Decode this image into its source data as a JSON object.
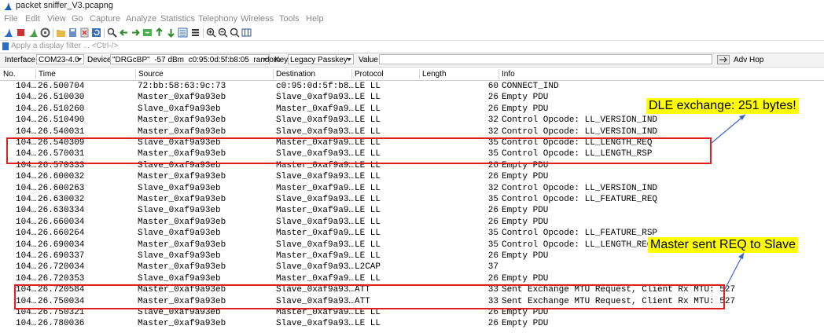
{
  "window": {
    "title": "packet sniffer_V3.pcapng"
  },
  "menu": [
    "File",
    "Edit",
    "View",
    "Go",
    "Capture",
    "Analyze",
    "Statistics",
    "Telephony",
    "Wireless",
    "Tools",
    "Help"
  ],
  "filter": {
    "placeholder": "Apply a display filter ... <Ctrl-/>"
  },
  "interface_bar": {
    "interface_label": "Interface",
    "interface_value": "COM23-4.0",
    "device_label": "Device",
    "device_value": "\"DRGcBP\"  -57 dBm  c0:95:0d:5f:b8:05  random",
    "key_label": "Key",
    "key_value": "Legacy Passkey",
    "value_label": "Value",
    "adv_hop_label": "Adv Hop"
  },
  "columns": [
    "No.",
    "Time",
    "Source",
    "Destination",
    "Protocol",
    "Length",
    "Info"
  ],
  "packets": [
    {
      "no": "104…",
      "time": "26.500704",
      "src": "72:bb:58:63:9c:73",
      "dst": "c0:95:0d:5f:b8…",
      "proto": "LE LL",
      "len": "60",
      "info": "CONNECT_IND"
    },
    {
      "no": "104…",
      "time": "26.510030",
      "src": "Master_0xaf9a93eb",
      "dst": "Slave_0xaf9a93…",
      "proto": "LE LL",
      "len": "26",
      "info": "Empty PDU"
    },
    {
      "no": "104…",
      "time": "26.510260",
      "src": "Slave_0xaf9a93eb",
      "dst": "Master_0xaf9a9…",
      "proto": "LE LL",
      "len": "26",
      "info": "Empty PDU"
    },
    {
      "no": "104…",
      "time": "26.510490",
      "src": "Master_0xaf9a93eb",
      "dst": "Slave_0xaf9a93…",
      "proto": "LE LL",
      "len": "32",
      "info": "Control Opcode: LL_VERSION_IND"
    },
    {
      "no": "104…",
      "time": "26.540031",
      "src": "Master_0xaf9a93eb",
      "dst": "Slave_0xaf9a93…",
      "proto": "LE LL",
      "len": "32",
      "info": "Control Opcode: LL_VERSION_IND"
    },
    {
      "no": "104…",
      "time": "26.540309",
      "src": "Slave_0xaf9a93eb",
      "dst": "Master_0xaf9a9…",
      "proto": "LE LL",
      "len": "35",
      "info": "Control Opcode: LL_LENGTH_REQ"
    },
    {
      "no": "104…",
      "time": "26.570031",
      "src": "Master_0xaf9a93eb",
      "dst": "Slave_0xaf9a93…",
      "proto": "LE LL",
      "len": "35",
      "info": "Control Opcode: LL_LENGTH_RSP"
    },
    {
      "no": "104…",
      "time": "26.570333",
      "src": "Slave_0xaf9a93eb",
      "dst": "Master_0xaf9a9…",
      "proto": "LE LL",
      "len": "26",
      "info": "Empty PDU"
    },
    {
      "no": "104…",
      "time": "26.600032",
      "src": "Master_0xaf9a93eb",
      "dst": "Slave_0xaf9a93…",
      "proto": "LE LL",
      "len": "26",
      "info": "Empty PDU"
    },
    {
      "no": "104…",
      "time": "26.600263",
      "src": "Slave_0xaf9a93eb",
      "dst": "Master_0xaf9a9…",
      "proto": "LE LL",
      "len": "32",
      "info": "Control Opcode: LL_VERSION_IND"
    },
    {
      "no": "104…",
      "time": "26.630032",
      "src": "Master_0xaf9a93eb",
      "dst": "Slave_0xaf9a93…",
      "proto": "LE LL",
      "len": "35",
      "info": "Control Opcode: LL_FEATURE_REQ"
    },
    {
      "no": "104…",
      "time": "26.630334",
      "src": "Slave_0xaf9a93eb",
      "dst": "Master_0xaf9a9…",
      "proto": "LE LL",
      "len": "26",
      "info": "Empty PDU"
    },
    {
      "no": "104…",
      "time": "26.660034",
      "src": "Master_0xaf9a93eb",
      "dst": "Slave_0xaf9a93…",
      "proto": "LE LL",
      "len": "26",
      "info": "Empty PDU"
    },
    {
      "no": "104…",
      "time": "26.660264",
      "src": "Slave_0xaf9a93eb",
      "dst": "Master_0xaf9a9…",
      "proto": "LE LL",
      "len": "35",
      "info": "Control Opcode: LL_FEATURE_RSP"
    },
    {
      "no": "104…",
      "time": "26.690034",
      "src": "Master_0xaf9a93eb",
      "dst": "Slave_0xaf9a93…",
      "proto": "LE LL",
      "len": "35",
      "info": "Control Opcode: LL_LENGTH_REQ"
    },
    {
      "no": "104…",
      "time": "26.690337",
      "src": "Slave_0xaf9a93eb",
      "dst": "Master_0xaf9a9…",
      "proto": "LE LL",
      "len": "26",
      "info": "Empty PDU"
    },
    {
      "no": "104…",
      "time": "26.720034",
      "src": "Master_0xaf9a93eb",
      "dst": "Slave_0xaf9a93…",
      "proto": "L2CAP",
      "len": "37",
      "info": ""
    },
    {
      "no": "104…",
      "time": "26.720353",
      "src": "Slave_0xaf9a93eb",
      "dst": "Master_0xaf9a9…",
      "proto": "LE LL",
      "len": "26",
      "info": "Empty PDU"
    },
    {
      "no": "104…",
      "time": "26.720584",
      "src": "Master_0xaf9a93eb",
      "dst": "Slave_0xaf9a93…",
      "proto": "ATT",
      "len": "33",
      "info": "Sent Exchange MTU Request, Client Rx MTU: 527"
    },
    {
      "no": "104…",
      "time": "26.750034",
      "src": "Master_0xaf9a93eb",
      "dst": "Slave_0xaf9a93…",
      "proto": "ATT",
      "len": "33",
      "info": "Sent Exchange MTU Request, Client Rx MTU: 527"
    },
    {
      "no": "104…",
      "time": "26.750321",
      "src": "Slave_0xaf9a93eb",
      "dst": "Master_0xaf9a9…",
      "proto": "LE LL",
      "len": "26",
      "info": "Empty PDU"
    },
    {
      "no": "104…",
      "time": "26.780036",
      "src": "Master_0xaf9a93eb",
      "dst": "Slave_0xaf9a93…",
      "proto": "LE LL",
      "len": "26",
      "info": "Empty PDU"
    }
  ],
  "annotations": {
    "dle_callout": "DLE exchange: 251 bytes!",
    "mtu_callout": "Master sent REQ to Slave"
  },
  "colors": {
    "highlight": "#e02020",
    "callout_bg": "#ffff00",
    "arrow": "#3a66c4"
  }
}
